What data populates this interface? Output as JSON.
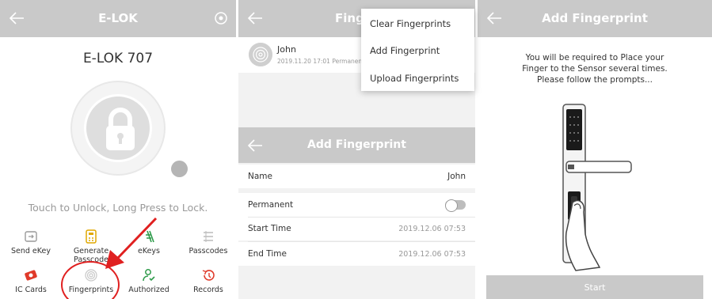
{
  "colors": {
    "topbar": "#c9c9c9",
    "accent_red": "#e02020",
    "icon_orange": "#e0a800",
    "icon_green": "#2e9b4a"
  },
  "panel1": {
    "title": "E-LOK",
    "lock_name": "E-LOK 707",
    "hint": "Touch to Unlock, Long Press to Lock.",
    "grid": [
      {
        "label": "Send eKey",
        "icon": "send-ekey-icon"
      },
      {
        "label": "Generate Passcode",
        "icon": "generate-passcode-icon"
      },
      {
        "label": "eKeys",
        "icon": "ekeys-icon"
      },
      {
        "label": "Passcodes",
        "icon": "passcodes-icon"
      },
      {
        "label": "IC Cards",
        "icon": "ic-cards-icon"
      },
      {
        "label": "Fingerprints",
        "icon": "fingerprint-icon"
      },
      {
        "label": "Authorized",
        "icon": "authorized-icon"
      },
      {
        "label": "Records",
        "icon": "records-icon"
      }
    ]
  },
  "panel2": {
    "title": "Fingerprints",
    "fingerprint_item": {
      "name": "John",
      "meta": "2019.11.20 17:01  Permanent"
    },
    "menu": [
      "Clear Fingerprints",
      "Add Fingerprint",
      "Upload Fingerprints"
    ],
    "sub": {
      "title": "Add Fingerprint",
      "name_label": "Name",
      "name_value": "John",
      "permanent_label": "Permanent",
      "start_label": "Start Time",
      "start_value": "2019.12.06 07:53",
      "end_label": "End Time",
      "end_value": "2019.12.06 07:53"
    }
  },
  "panel3": {
    "title": "Add Fingerprint",
    "instructions": [
      "You will be required to Place your",
      "Finger to the Sensor several times.",
      "Please follow the prompts..."
    ],
    "start_label": "Start"
  }
}
